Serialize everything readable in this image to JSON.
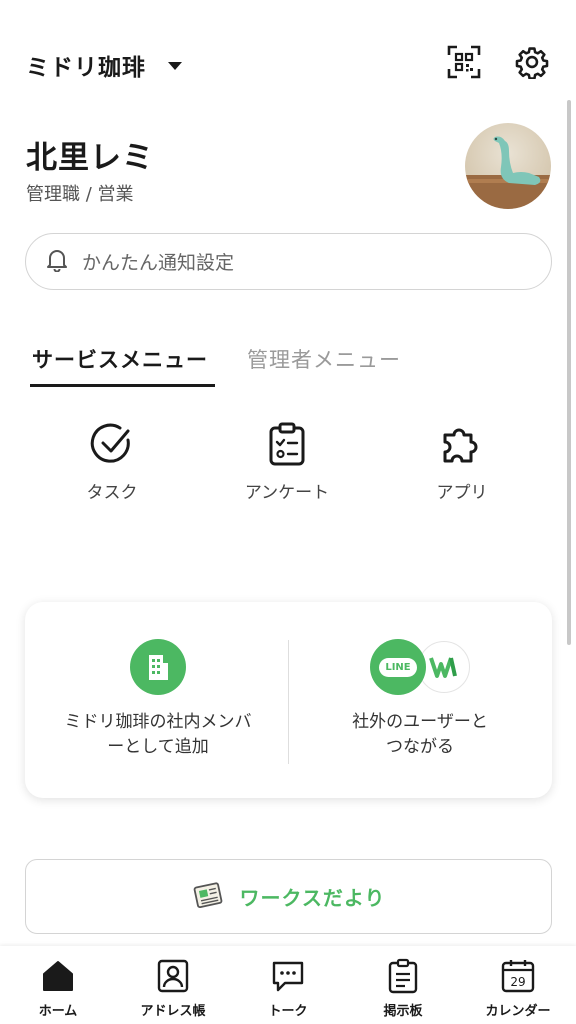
{
  "header": {
    "org_name": "ミドリ珈琲"
  },
  "profile": {
    "name": "北里レミ",
    "role": "管理職 / 営業"
  },
  "notification": {
    "label": "かんたん通知設定"
  },
  "tabs": [
    {
      "label": "サービスメニュー",
      "active": true
    },
    {
      "label": "管理者メニュー",
      "active": false
    }
  ],
  "services": [
    {
      "label": "タスク",
      "icon": "check-circle-icon"
    },
    {
      "label": "アンケート",
      "icon": "clipboard-icon"
    },
    {
      "label": "アプリ",
      "icon": "puzzle-icon"
    }
  ],
  "invite": {
    "internal": {
      "line1": "ミドリ珈琲の社内メンバ",
      "line2": "ーとして追加",
      "icon": "building-icon"
    },
    "external": {
      "line1": "社外のユーザーと",
      "line2": "つながる",
      "line_logo": "LINE",
      "icon": "line-works-icon"
    }
  },
  "news": {
    "label": "ワークスだより",
    "icon": "newspaper-icon"
  },
  "bottom_nav": [
    {
      "label": "ホーム",
      "icon": "home-icon",
      "active": true
    },
    {
      "label": "アドレス帳",
      "icon": "address-book-icon",
      "active": false
    },
    {
      "label": "トーク",
      "icon": "chat-icon",
      "active": false
    },
    {
      "label": "掲示板",
      "icon": "board-icon",
      "active": false
    },
    {
      "label": "カレンダー",
      "icon": "calendar-icon",
      "active": false,
      "date": "29"
    }
  ],
  "colors": {
    "accent": "#4cb862",
    "text": "#1a1a1a",
    "muted": "#9a9a9a"
  }
}
